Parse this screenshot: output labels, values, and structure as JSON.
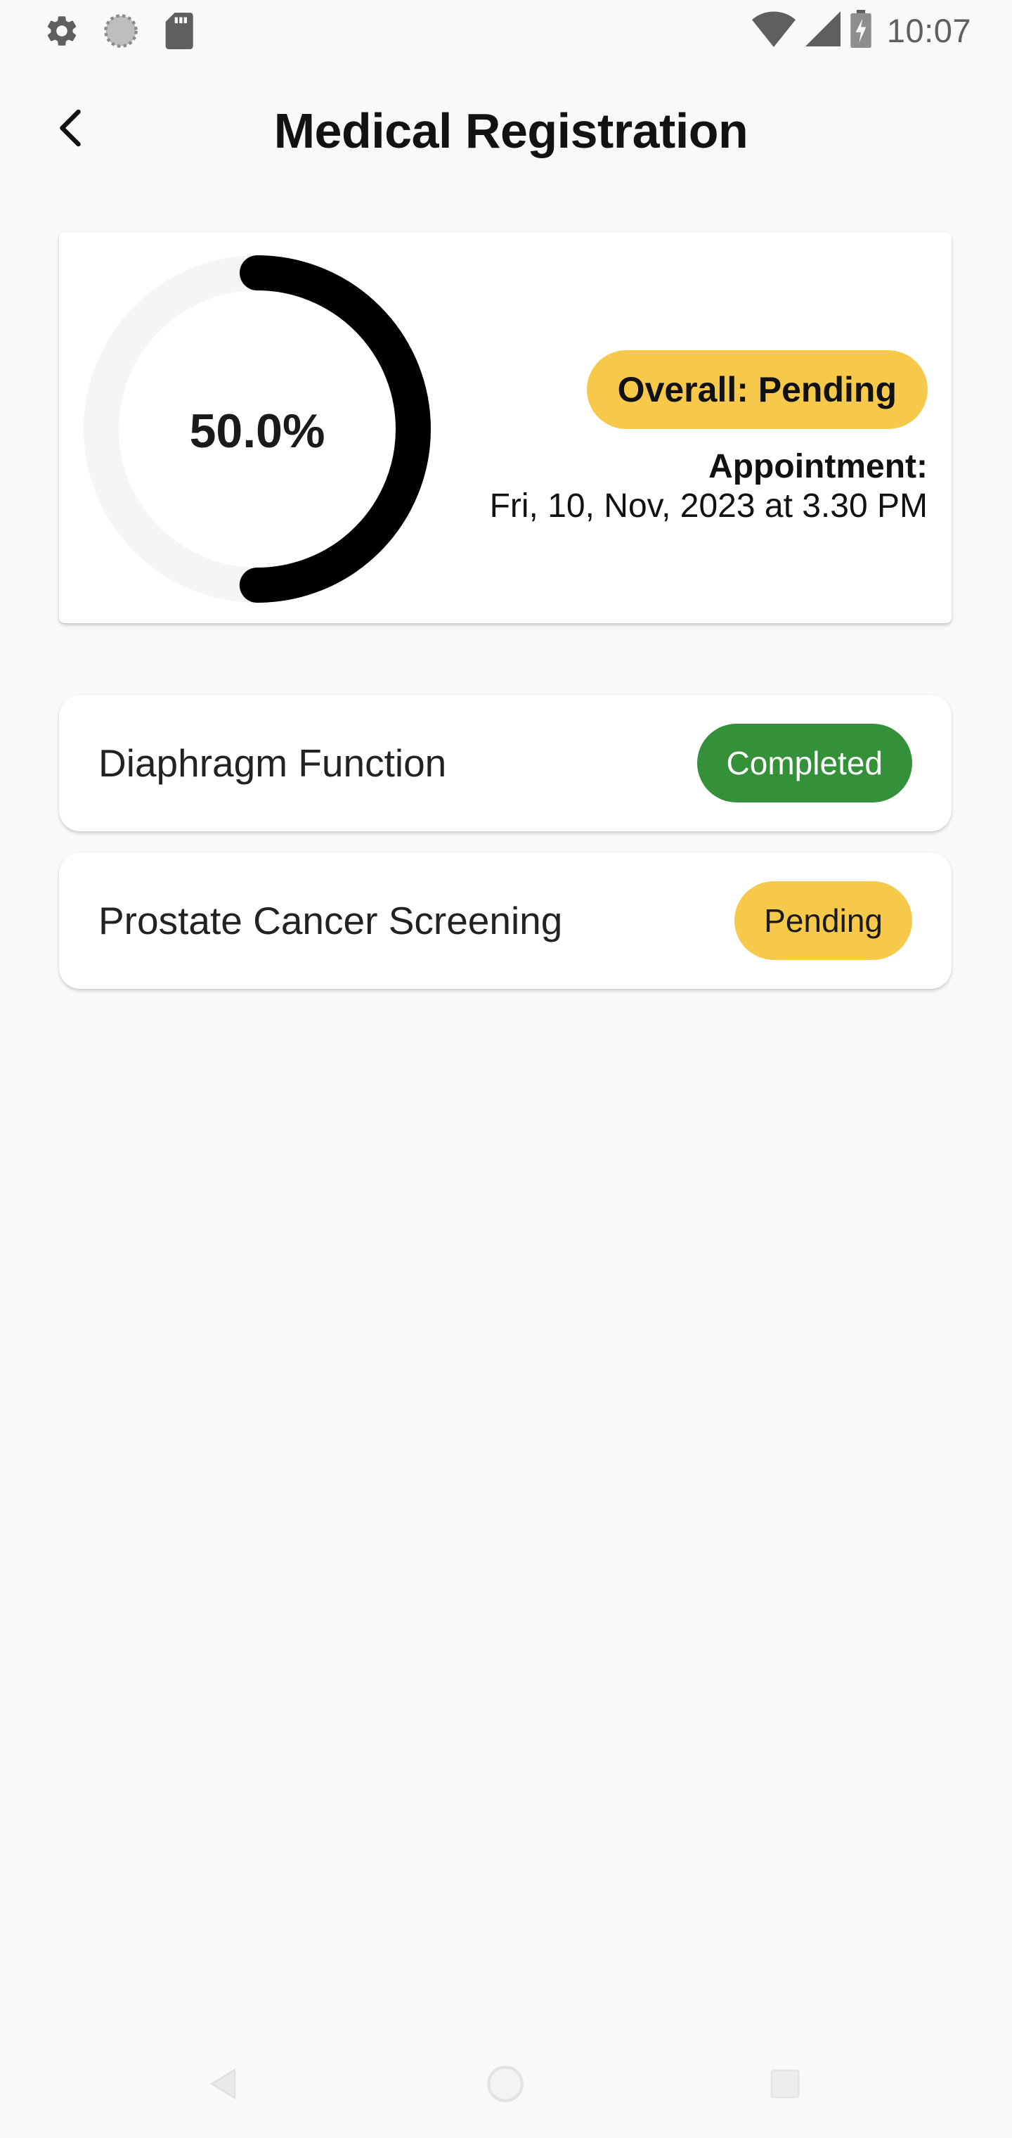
{
  "status_bar": {
    "time": "10:07",
    "icons": [
      "settings-icon",
      "sync-icon",
      "sd-card-icon",
      "wifi-icon",
      "cell-signal-icon",
      "battery-charging-icon"
    ],
    "icon_color": "#5f5f5f"
  },
  "app_bar": {
    "title": "Medical Registration",
    "back_icon": "chevron-left-icon"
  },
  "summary": {
    "progress_text": "50.0%",
    "progress_value": 0.5,
    "progress_color": "#000000",
    "progress_track_color": "#f5f5f5",
    "overall_status": "Overall: Pending",
    "overall_status_color": "#f7c94b",
    "appointment_label": "Appointment:",
    "appointment_datetime": "Fri, 10, Nov, 2023 at 3.30 PM"
  },
  "tests": [
    {
      "name": "Diaphragm Function",
      "status": "Completed",
      "status_color": "#35903a"
    },
    {
      "name": "Prostate Cancer Screening",
      "status": "Pending",
      "status_color": "#f7c94b"
    }
  ],
  "nav_bar": {
    "icons": [
      "back-triangle-icon",
      "home-circle-icon",
      "recents-square-icon"
    ]
  }
}
